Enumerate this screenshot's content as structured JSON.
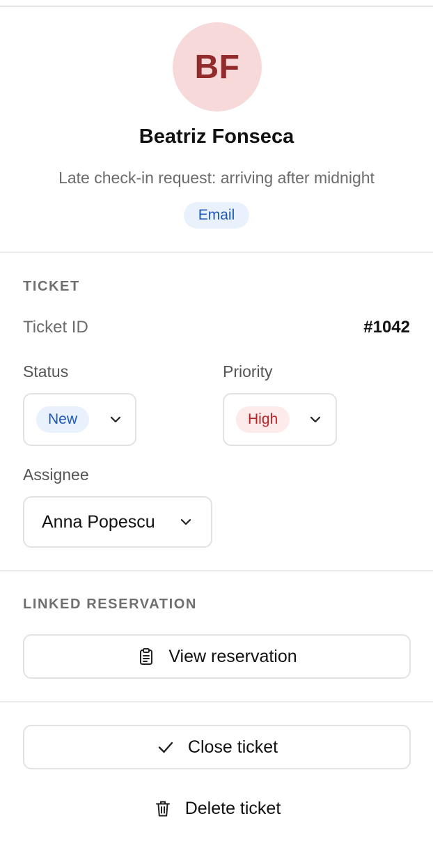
{
  "contact": {
    "initials": "BF",
    "name": "Beatriz Fonseca",
    "subject": "Late check-in request: arriving after midnight",
    "channel": "Email"
  },
  "ticket": {
    "section_title": "TICKET",
    "id_label": "Ticket ID",
    "id_value": "#1042",
    "status_label": "Status",
    "status_value": "New",
    "priority_label": "Priority",
    "priority_value": "High",
    "assignee_label": "Assignee",
    "assignee_value": "Anna Popescu"
  },
  "reservation": {
    "section_title": "LINKED RESERVATION",
    "view_button": "View reservation"
  },
  "actions": {
    "close_button": "Close ticket",
    "delete_button": "Delete ticket"
  },
  "icons": {
    "status_chevron": "chevron-down-icon",
    "priority_chevron": "chevron-down-icon",
    "assignee_chevron": "chevron-down-icon",
    "view_reservation": "clipboard-icon",
    "close_ticket": "check-icon",
    "delete_ticket": "trash-icon"
  },
  "colors": {
    "avatar_bg": "#f8d9d9",
    "avatar_text": "#922b2b",
    "badge_blue_bg": "#e8f1fc",
    "badge_blue_text": "#1f57b8",
    "badge_red_bg": "#fdeaea",
    "badge_red_text": "#b42323"
  }
}
